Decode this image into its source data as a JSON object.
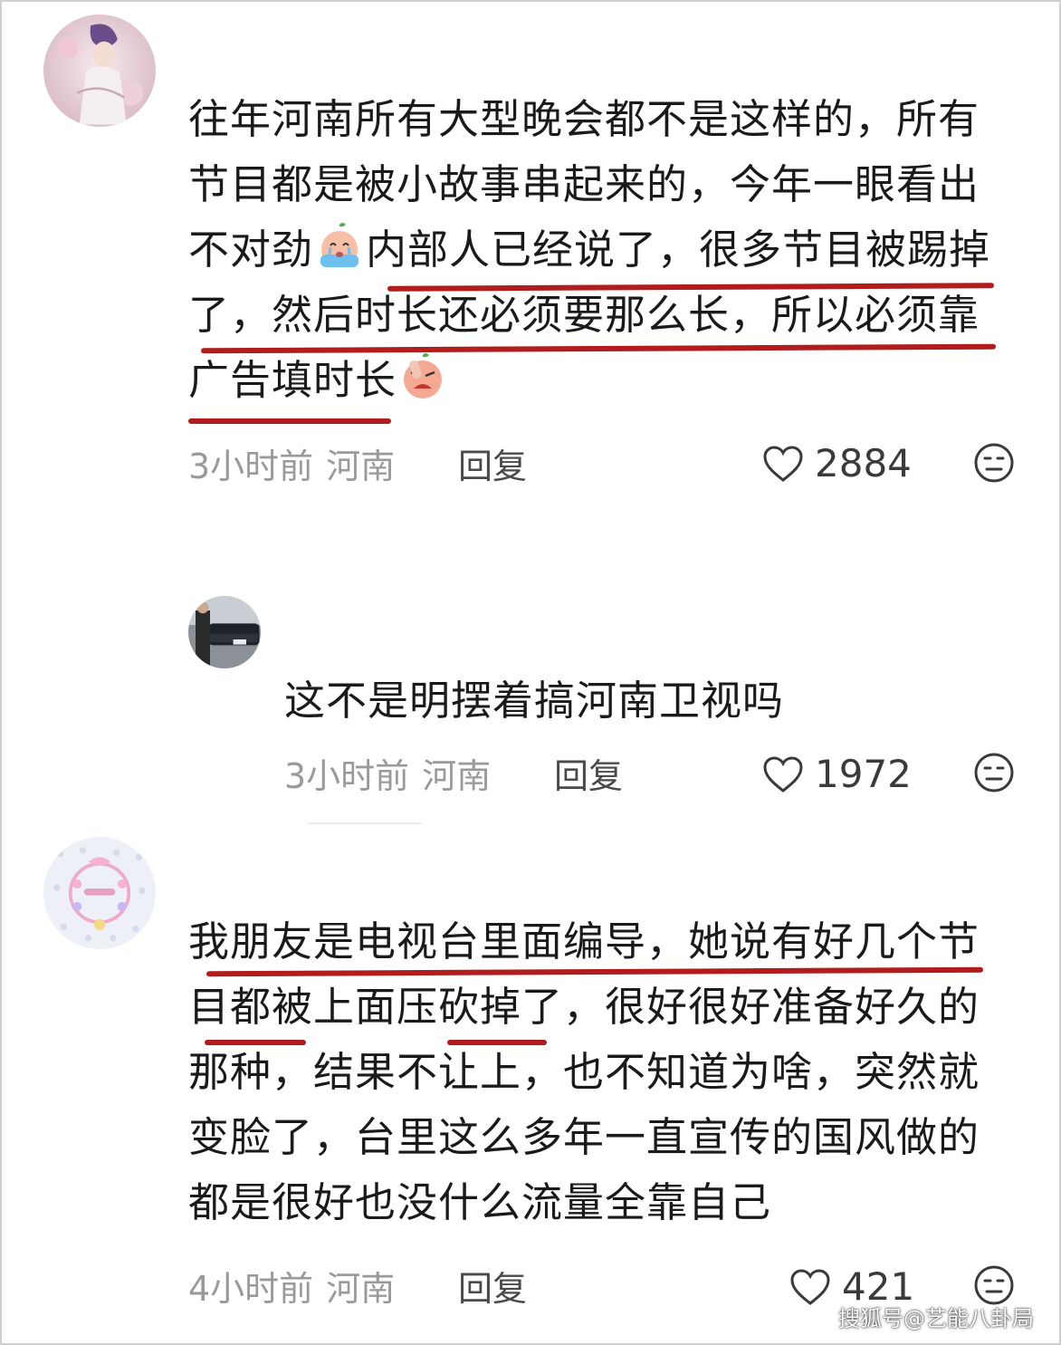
{
  "comments": [
    {
      "text_lines": [
        "往年河南所有大型晚会都不是这样的，所有",
        "节目都是被小故事串起来的，今年一眼看出",
        [
          "不对劲",
          "内部人已经说了，很多节目被踢掉"
        ],
        "了，然后时长还必须要那么长，所以必须靠",
        "广告填时长"
      ],
      "time": "3小时前",
      "location": "河南",
      "reply_label": "回复",
      "likes": "2884",
      "emoji_1": "crying-face-emoji",
      "emoji_2": "frustrated-face-emoji"
    },
    {
      "text_lines": [
        "这不是明摆着搞河南卫视吗"
      ],
      "time": "3小时前",
      "location": "河南",
      "reply_label": "回复",
      "likes": "1972"
    },
    {
      "text_lines": [
        "我朋友是电视台里面编导，她说有好几个节",
        "目都被上面压砍掉了，很好很好准备好久的",
        "那种，结果不让上，也不知道为啥，突然就",
        "变脸了，台里这么多年一直宣传的国风做的",
        "都是很好也没什么流量全靠自己"
      ],
      "time": "4小时前",
      "location": "河南",
      "reply_label": "回复",
      "likes": "421"
    }
  ],
  "watermark": "搜狐号@艺能八卦局",
  "colors": {
    "underline": "#b11c1c",
    "meta_gray": "#9a9a9a",
    "text": "#1a1a1a"
  }
}
